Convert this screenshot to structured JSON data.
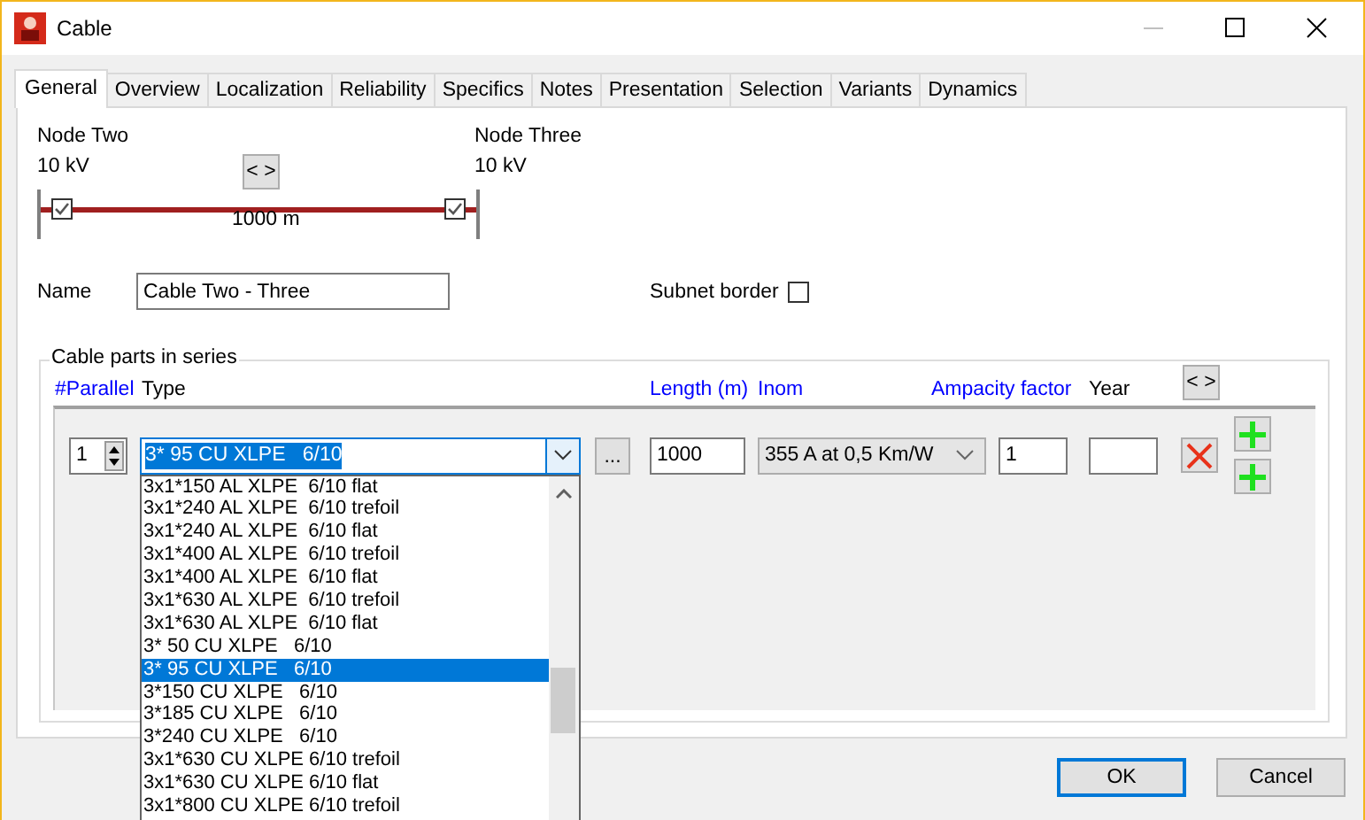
{
  "window": {
    "title": "Cable"
  },
  "tabs": [
    {
      "label": "General",
      "selected": true
    },
    {
      "label": "Overview",
      "selected": false
    },
    {
      "label": "Localization",
      "selected": false
    },
    {
      "label": "Reliability",
      "selected": false
    },
    {
      "label": "Specifics",
      "selected": false
    },
    {
      "label": "Notes",
      "selected": false
    },
    {
      "label": "Presentation",
      "selected": false
    },
    {
      "label": "Selection",
      "selected": false
    },
    {
      "label": "Variants",
      "selected": false
    },
    {
      "label": "Dynamics",
      "selected": false
    }
  ],
  "connection": {
    "from_node": {
      "name": "Node Two",
      "voltage": "10 kV",
      "switch_closed": true
    },
    "to_node": {
      "name": "Node Three",
      "voltage": "10 kV",
      "switch_closed": true
    },
    "swap_button": "< >",
    "length": "1000 m"
  },
  "name_field": {
    "label": "Name",
    "value": "Cable Two - Three"
  },
  "subnet_border": {
    "label": "Subnet border",
    "checked": false
  },
  "cable_parts": {
    "title": "Cable parts in series",
    "columns": [
      {
        "label": "#Parallel",
        "color": "#0000ff"
      },
      {
        "label": "Type",
        "color": "#000000"
      },
      {
        "label": "Length (m)",
        "color": "#0000ff"
      },
      {
        "label": "Inom",
        "color": "#0000ff"
      },
      {
        "label": "Ampacity factor",
        "color": "#0000ff"
      },
      {
        "label": "Year",
        "color": "#000000"
      }
    ],
    "swap_button": "< >",
    "row": {
      "parallel": "1",
      "type": "3* 95 CU XLPE   6/10",
      "length": "1000",
      "inom": "355 A at 0,5 Km/W",
      "ampacity_factor": "1",
      "browse_button": "..."
    },
    "dropdown": {
      "items": [
        {
          "label": "3x1*150 AL XLPE  6/10 flat",
          "selected": false
        },
        {
          "label": "3x1*240 AL XLPE  6/10 trefoil",
          "selected": false
        },
        {
          "label": "3x1*240 AL XLPE  6/10 flat",
          "selected": false
        },
        {
          "label": "3x1*400 AL XLPE  6/10 trefoil",
          "selected": false
        },
        {
          "label": "3x1*400 AL XLPE  6/10 flat",
          "selected": false
        },
        {
          "label": "3x1*630 AL XLPE  6/10 trefoil",
          "selected": false
        },
        {
          "label": "3x1*630 AL XLPE  6/10 flat",
          "selected": false
        },
        {
          "label": "3* 50 CU XLPE   6/10",
          "selected": false
        },
        {
          "label": "3* 95 CU XLPE   6/10",
          "selected": true
        },
        {
          "label": "3*150 CU XLPE   6/10",
          "selected": false
        },
        {
          "label": "3*185 CU XLPE   6/10",
          "selected": false
        },
        {
          "label": "3*240 CU XLPE   6/10",
          "selected": false
        },
        {
          "label": "3x1*630 CU XLPE 6/10 trefoil",
          "selected": false
        },
        {
          "label": "3x1*630 CU XLPE 6/10 flat",
          "selected": false
        },
        {
          "label": "3x1*800 CU XLPE 6/10 trefoil",
          "selected": false
        }
      ]
    }
  },
  "buttons": [
    {
      "label": "OK",
      "default": true
    },
    {
      "label": "Cancel",
      "default": false
    }
  ]
}
